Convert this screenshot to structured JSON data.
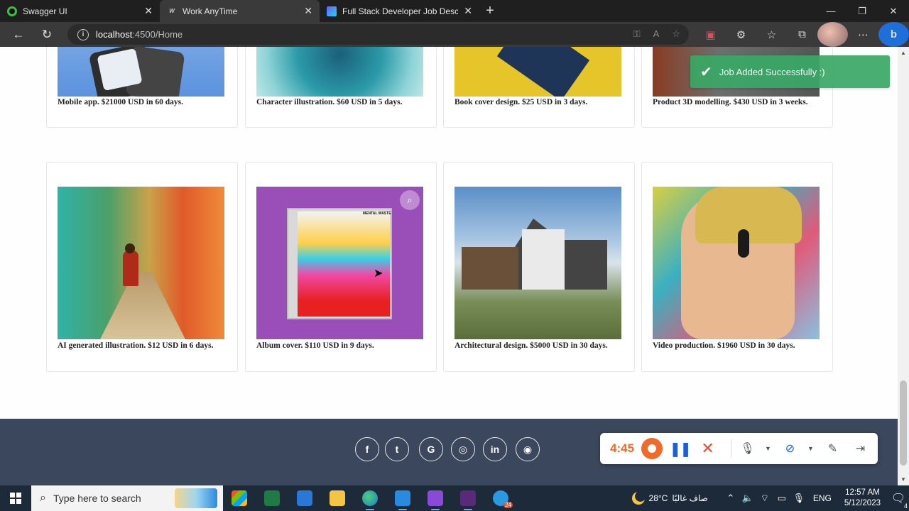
{
  "browser": {
    "tabs": [
      {
        "title": "Swagger UI",
        "active": false
      },
      {
        "title": "Work AnyTime",
        "active": true
      },
      {
        "title": "Full Stack Developer Job Description",
        "active": false
      }
    ],
    "url_host": "localhost",
    "url_rest": ":4500/Home"
  },
  "cards_top": [
    {
      "caption": "Mobile app. $21000 USD in 60 days."
    },
    {
      "caption": "Character illustration. $60 USD in 5 days."
    },
    {
      "caption": "Book cover design. $25 USD in 3 days."
    },
    {
      "caption": "Product 3D modelling. $430 USD in 3 weeks."
    }
  ],
  "cards_bottom": [
    {
      "caption": "AI generated illustration. $12 USD in 6 days."
    },
    {
      "caption": "Album cover. $110 USD in 9 days."
    },
    {
      "caption": "Architectural design. $5000 USD in 30 days."
    },
    {
      "caption": "Video production. $1960 USD in 30 days."
    }
  ],
  "album_sticker": "MENTAL WASTE",
  "toast": {
    "message": "Job Added Successfully :)",
    "color": "#3aa866"
  },
  "footer": {
    "color": "#3b475c",
    "social": [
      {
        "name": "facebook",
        "glyph": "f"
      },
      {
        "name": "twitter",
        "glyph": "t"
      },
      {
        "name": "google",
        "glyph": "G"
      },
      {
        "name": "instagram",
        "glyph": "◎"
      },
      {
        "name": "linkedin",
        "glyph": "in"
      },
      {
        "name": "github",
        "glyph": "◉"
      }
    ]
  },
  "recorder": {
    "time": "4:45"
  },
  "taskbar": {
    "search_placeholder": "Type here to search",
    "weather_temp": "28°C",
    "weather_text": "صاف غالبًا",
    "language": "ENG",
    "time": "12:57 AM",
    "date": "5/12/2023",
    "notification_count": "4",
    "edge_badge": "24"
  }
}
